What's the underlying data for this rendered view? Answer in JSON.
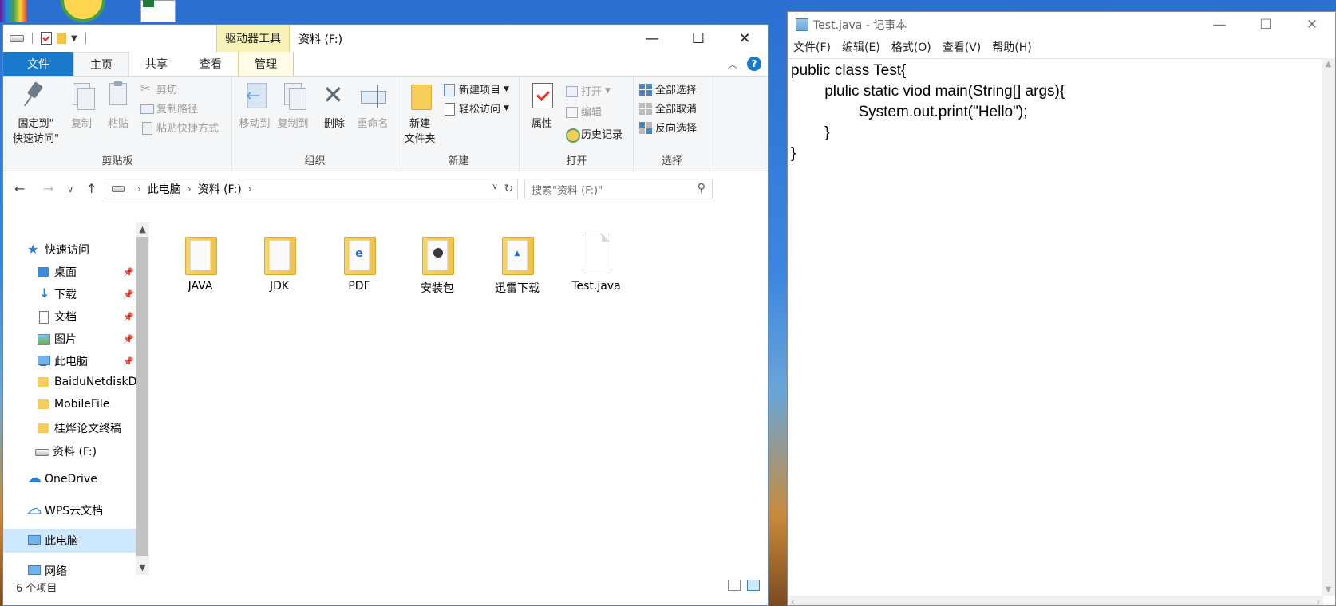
{
  "explorer": {
    "context_tool": "驱动器工具",
    "title": "资料 (F:)",
    "controls": {
      "minimize": "—",
      "maximize": "☐",
      "close": "✕"
    },
    "tabs": {
      "file": "文件",
      "home": "主页",
      "share": "共享",
      "view": "查看",
      "manage": "管理"
    },
    "ribbon": {
      "clipboard": {
        "pin_line1": "固定到\"",
        "pin_line2": "快速访问\"",
        "copy": "复制",
        "paste": "粘贴",
        "cut": "剪切",
        "copy_path": "复制路径",
        "paste_shortcut": "粘贴快捷方式",
        "label": "剪贴板"
      },
      "organize": {
        "move_to": "移动到",
        "copy_to": "复制到",
        "delete": "删除",
        "rename": "重命名",
        "label": "组织"
      },
      "new": {
        "new_folder_line1": "新建",
        "new_folder_line2": "文件夹",
        "new_item": "新建项目",
        "easy_access": "轻松访问",
        "label": "新建"
      },
      "open": {
        "properties": "属性",
        "open": "打开",
        "edit": "编辑",
        "history": "历史记录",
        "label": "打开"
      },
      "select": {
        "select_all": "全部选择",
        "select_none": "全部取消",
        "invert": "反向选择",
        "label": "选择"
      }
    },
    "address": {
      "crumb1": "此电脑",
      "crumb2": "资料 (F:)",
      "sep": "›"
    },
    "search": {
      "placeholder": "搜索\"资料 (F:)\""
    },
    "nav": {
      "quick_access": "快速访问",
      "desktop": "桌面",
      "downloads": "下载",
      "documents": "文档",
      "pictures": "图片",
      "this_pc_pinned": "此电脑",
      "baidu": "BaiduNetdiskDownload",
      "mobilefile": "MobileFile",
      "thesis": "桂烨论文终稿",
      "drive_f": "资料 (F:)",
      "onedrive": "OneDrive",
      "wps": "WPS云文档",
      "this_pc": "此电脑",
      "network": "网络"
    },
    "files": [
      {
        "name": "JAVA",
        "type": "folder"
      },
      {
        "name": "JDK",
        "type": "folder"
      },
      {
        "name": "PDF",
        "type": "folder-edge"
      },
      {
        "name": "安装包",
        "type": "folder-pkg"
      },
      {
        "name": "迅雷下载",
        "type": "folder-xl"
      },
      {
        "name": "Test.java",
        "type": "file"
      }
    ],
    "status": {
      "count": "6 个项目"
    }
  },
  "notepad": {
    "title": "Test.java - 记事本",
    "menu": {
      "file": "文件(F)",
      "edit": "编辑(E)",
      "format": "格式(O)",
      "view": "查看(V)",
      "help": "帮助(H)"
    },
    "content": "public class Test{\n\tplulic static viod main(String[] args){\n\t\tSystem.out.print(\"Hello\");\n\t}\n}"
  }
}
